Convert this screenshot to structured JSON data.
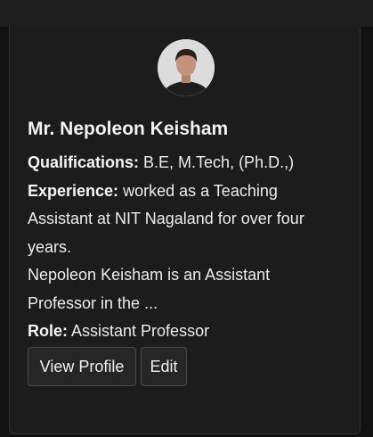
{
  "profile": {
    "name": "Mr. Nepoleon Keisham",
    "qualifications_label": "Qualifications:",
    "qualifications": "B.E, M.Tech, (Ph.D.,)",
    "experience_label": "Experience:",
    "experience": "worked as a Teaching Assistant at NIT Nagaland for over four years.",
    "bio": "Nepoleon Keisham is an Assistant Professor in the ...",
    "role_label": "Role:",
    "role": "Assistant Professor"
  },
  "actions": {
    "view_profile": "View Profile",
    "edit": "Edit"
  }
}
